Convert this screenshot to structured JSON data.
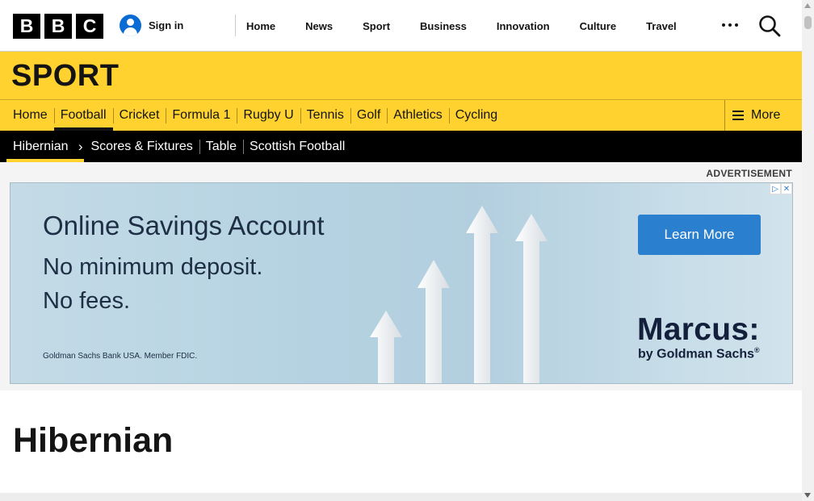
{
  "header": {
    "logo_letters": [
      "B",
      "B",
      "C"
    ],
    "signin_label": "Sign in",
    "nav": [
      "Home",
      "News",
      "Sport",
      "Business",
      "Innovation",
      "Culture",
      "Travel"
    ],
    "icons": {
      "more": "more-dots-icon",
      "search": "search-icon",
      "avatar": "user-avatar-icon"
    }
  },
  "sport": {
    "title": "SPORT",
    "nav": [
      "Home",
      "Football",
      "Cricket",
      "Formula 1",
      "Rugby U",
      "Tennis",
      "Golf",
      "Athletics",
      "Cycling"
    ],
    "active": "Football",
    "more_label": "More"
  },
  "subnav": {
    "current": "Hibernian",
    "items": [
      "Scores & Fixtures",
      "Table",
      "Scottish Football"
    ]
  },
  "advert": {
    "label": "ADVERTISEMENT",
    "headline": "Online Savings Account",
    "line2": "No minimum deposit.",
    "line3": "No fees.",
    "fine_print": "Goldman Sachs Bank USA. Member FDIC.",
    "cta": "Learn More",
    "brand": "Marcus:",
    "brand_sub": "by Goldman Sachs",
    "brand_mark": "®"
  },
  "page": {
    "title": "Hibernian"
  },
  "colors": {
    "sport_yellow": "#ffd230",
    "cta_blue": "#2a7fce",
    "signin_blue": "#0b6bd4"
  }
}
